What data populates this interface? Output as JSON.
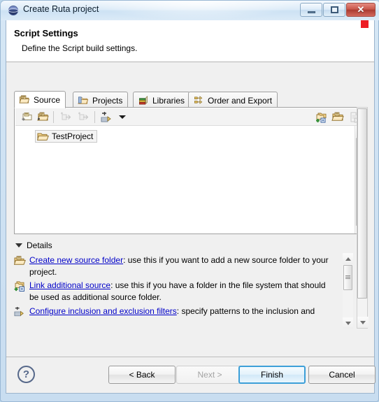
{
  "window": {
    "title": "Create Ruta project",
    "icon": "eclipse-sphere-icon",
    "controls": {
      "minimize": "minimize-icon",
      "maximize": "restore-icon",
      "close": "✕"
    }
  },
  "header": {
    "title": "Script Settings",
    "subtitle": "Define the Script build settings.",
    "error_marker_color": "#ed1c24"
  },
  "tabs": [
    {
      "label": "Source",
      "icon": "source-folder-icon",
      "active": true
    },
    {
      "label": "Projects",
      "icon": "projects-folder-icon",
      "active": false
    },
    {
      "label": "Libraries",
      "icon": "libraries-books-icon",
      "active": false
    },
    {
      "label": "Order and Export",
      "icon": "order-export-icon",
      "active": false
    }
  ],
  "tree_toolbar": {
    "left_buttons": [
      {
        "name": "add-folder-button",
        "icon": "folder-add-icon",
        "enabled": true
      },
      {
        "name": "add-source-folder-button",
        "icon": "folder-source-add-icon",
        "enabled": true
      },
      {
        "name": "move-up-button",
        "icon": "move-in-icon",
        "enabled": false
      },
      {
        "name": "move-down-button",
        "icon": "move-out-icon",
        "enabled": false
      },
      {
        "name": "filter-button",
        "icon": "filter-icon",
        "enabled": true
      },
      {
        "name": "filter-dropdown-button",
        "icon": "chevron-down-icon",
        "enabled": true
      }
    ],
    "right_buttons": [
      {
        "name": "link-source-button",
        "icon": "link-source-icon",
        "enabled": true
      },
      {
        "name": "new-folder-button",
        "icon": "new-folder-icon",
        "enabled": true
      },
      {
        "name": "remove-entry-button",
        "icon": "remove-file-icon",
        "enabled": false
      }
    ]
  },
  "tree": {
    "items": [
      {
        "label": "TestProject",
        "icon": "open-folder-icon",
        "selected": true
      }
    ]
  },
  "details": {
    "toggle_label": "Details",
    "expanded": true,
    "items": [
      {
        "icon": "create-source-folder-icon",
        "link": "Create new source folder",
        "text": ": use this if you want to add a new source folder to your project."
      },
      {
        "icon": "link-additional-source-icon",
        "link": "Link additional source",
        "text": ": use this if you have a folder in the file system that should be used as additional source folder."
      },
      {
        "icon": "configure-filters-icon",
        "link": "Configure inclusion and exclusion filters",
        "text": ": specify patterns to the inclusion and"
      }
    ]
  },
  "footer": {
    "help_label": "?",
    "buttons": [
      {
        "name": "back-button",
        "label": "< Back",
        "enabled": true,
        "default": false
      },
      {
        "name": "next-button",
        "label": "Next >",
        "enabled": false,
        "default": false
      },
      {
        "name": "finish-button",
        "label": "Finish",
        "enabled": true,
        "default": true
      },
      {
        "name": "cancel-button",
        "label": "Cancel",
        "enabled": true,
        "default": false
      }
    ]
  }
}
